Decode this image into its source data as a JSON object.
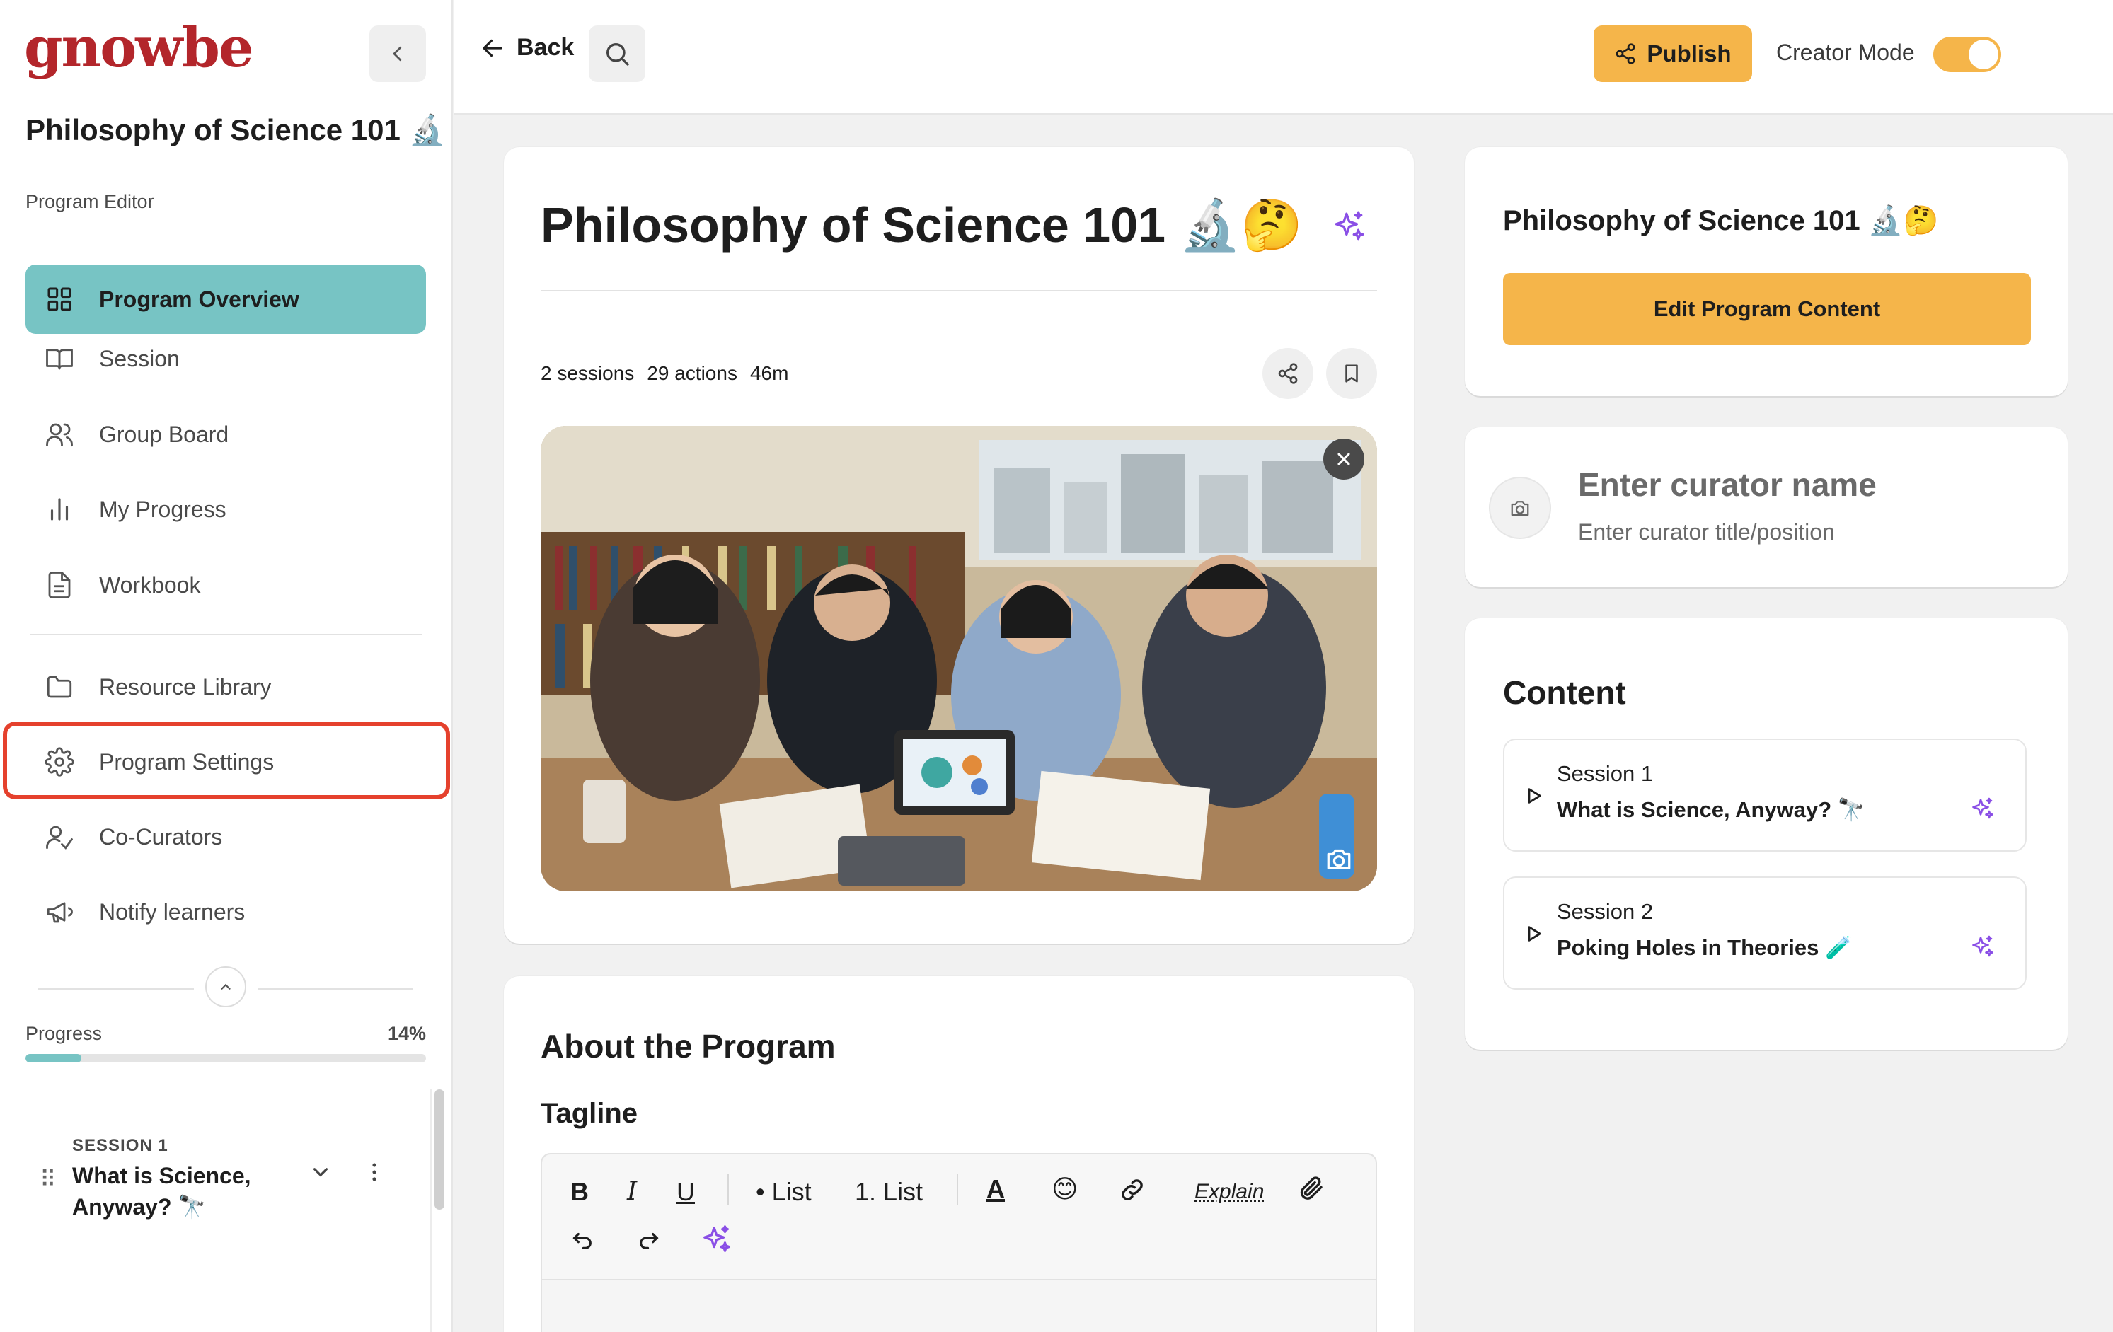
{
  "brand": {
    "logo": "gnowbe",
    "accent": "#77c4c4",
    "primary": "#f5b54a",
    "logo_color": "#b3262b",
    "highlight": "#e5412d"
  },
  "sidebar": {
    "program_title": "Philosophy of Science 101 🔬",
    "section_label": "Program Editor",
    "items": [
      {
        "label": "Program Overview",
        "icon": "grid-icon",
        "active": true
      },
      {
        "label": "Session",
        "icon": "book-open-icon"
      },
      {
        "label": "Group Board",
        "icon": "users-icon"
      },
      {
        "label": "My Progress",
        "icon": "bar-chart-icon"
      },
      {
        "label": "Workbook",
        "icon": "document-icon"
      },
      {
        "label": "Resource Library",
        "icon": "folder-icon"
      },
      {
        "label": "Program Settings",
        "icon": "gear-icon",
        "highlighted": true
      },
      {
        "label": "Co-Curators",
        "icon": "user-plus-icon"
      },
      {
        "label": "Notify learners",
        "icon": "megaphone-icon"
      }
    ],
    "progress": {
      "label": "Progress",
      "value_text": "14%",
      "fraction": 0.14
    },
    "current_session": {
      "kicker": "SESSION 1",
      "title": "What is Science, Anyway? 🔭"
    }
  },
  "topbar": {
    "back_label": "Back",
    "publish_label": "Publish",
    "creator_mode_label": "Creator Mode",
    "creator_mode_on": true
  },
  "main": {
    "title": "Philosophy of Science 101 🔬🤔",
    "meta": {
      "sessions": "2 sessions",
      "actions": "29 actions",
      "duration": "46m"
    },
    "hero_image_alt": "students studying together in a library"
  },
  "about": {
    "title": "About the Program",
    "tagline_label": "Tagline",
    "toolbar": {
      "bold": "B",
      "italic": "I",
      "underline": "U",
      "bullet_list": "• List",
      "numbered_list": "1. List",
      "text_color": "A",
      "emoji": "😊",
      "explain": "Explain"
    }
  },
  "right": {
    "program_title": "Philosophy of Science 101 🔬🤔",
    "edit_button": "Edit Program Content",
    "curator_name_placeholder": "Enter curator name",
    "curator_title_placeholder": "Enter curator title/position",
    "content_title": "Content",
    "sessions": [
      {
        "label": "Session 1",
        "title": "What is Science, Anyway? 🔭"
      },
      {
        "label": "Session 2",
        "title": "Poking Holes in Theories 🧪"
      }
    ]
  }
}
